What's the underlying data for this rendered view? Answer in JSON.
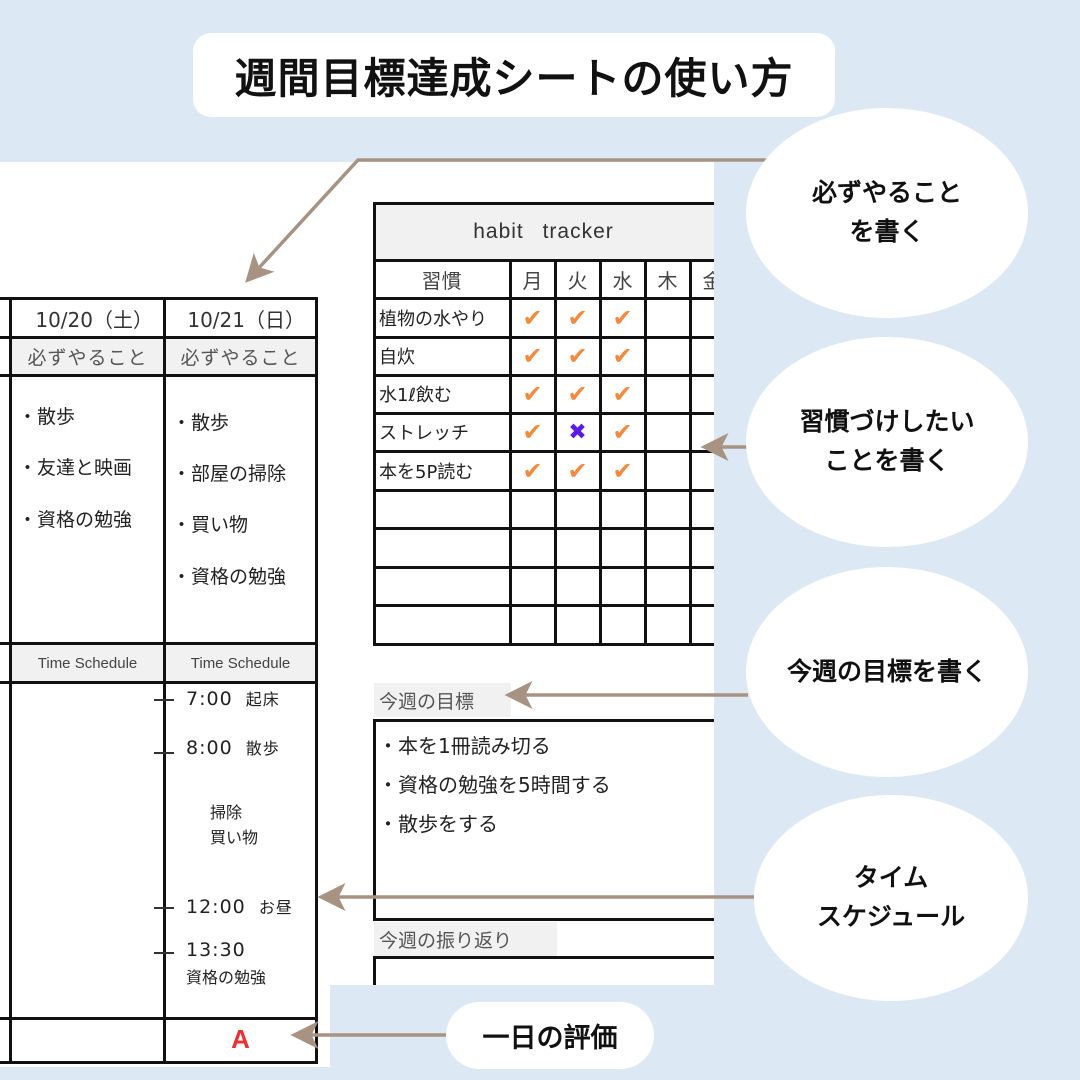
{
  "title": "週間目標達成シートの使い方",
  "left_sheet": {
    "days": [
      {
        "date": "10/20（土）",
        "must_label": "必ずやること",
        "todos": [
          "・散歩",
          "・友達と映画",
          "・資格の勉強"
        ],
        "schedule_label": "Time Schedule",
        "schedule": [],
        "grade": ""
      },
      {
        "date": "10/21（日）",
        "must_label": "必ずやること",
        "todos": [
          "・散歩",
          "・部屋の掃除",
          "・買い物",
          "・資格の勉強"
        ],
        "schedule_label": "Time Schedule",
        "schedule": [
          {
            "time": "7:00",
            "text": "起床"
          },
          {
            "time": "8:00",
            "text": "散歩"
          },
          {
            "time": "",
            "text": "掃除"
          },
          {
            "time": "",
            "text": "買い物"
          },
          {
            "time": "12:00",
            "text": "お昼"
          },
          {
            "time": "13:30",
            "text": "資格の勉強"
          }
        ],
        "grade": "A"
      }
    ]
  },
  "habit_tracker": {
    "title": "habit tracker",
    "habit_header": "習慣",
    "days": [
      "月",
      "火",
      "水",
      "木",
      "金"
    ],
    "rows": [
      {
        "habit": "植物の水やり",
        "marks": [
          "check",
          "check",
          "check",
          "",
          ""
        ]
      },
      {
        "habit": "自炊",
        "marks": [
          "check",
          "check",
          "check",
          "",
          ""
        ]
      },
      {
        "habit": "水1ℓ飲む",
        "marks": [
          "check",
          "check",
          "check",
          "",
          ""
        ]
      },
      {
        "habit": "ストレッチ",
        "marks": [
          "check",
          "cross",
          "check",
          "",
          ""
        ]
      },
      {
        "habit": "本を5P読む",
        "marks": [
          "check",
          "check",
          "check",
          "",
          ""
        ]
      },
      {
        "habit": "",
        "marks": [
          "",
          "",
          "",
          "",
          ""
        ]
      },
      {
        "habit": "",
        "marks": [
          "",
          "",
          "",
          "",
          ""
        ]
      },
      {
        "habit": "",
        "marks": [
          "",
          "",
          "",
          "",
          ""
        ]
      },
      {
        "habit": "",
        "marks": [
          "",
          "",
          "",
          "",
          ""
        ]
      }
    ],
    "mark_glyphs": {
      "check": "✔",
      "cross": "✖"
    }
  },
  "weekly_goal": {
    "label": "今週の目標",
    "items": [
      "・本を1冊読み切る",
      "・資格の勉強を5時間する",
      "・散歩をする"
    ]
  },
  "weekly_review": {
    "label": "今週の振り返り"
  },
  "callouts": {
    "must_do": "必ずやること\nを書く",
    "habit": "習慣づけしたい\nことを書く",
    "goal": "今週の目標を書く",
    "schedule": "タイム\nスケジュール",
    "evaluation": "一日の評価"
  },
  "colors": {
    "background": "#dce8f4",
    "arrow": "#a89282",
    "check": "#f5893c",
    "cross": "#5b1be6",
    "grade": "#f03030"
  }
}
